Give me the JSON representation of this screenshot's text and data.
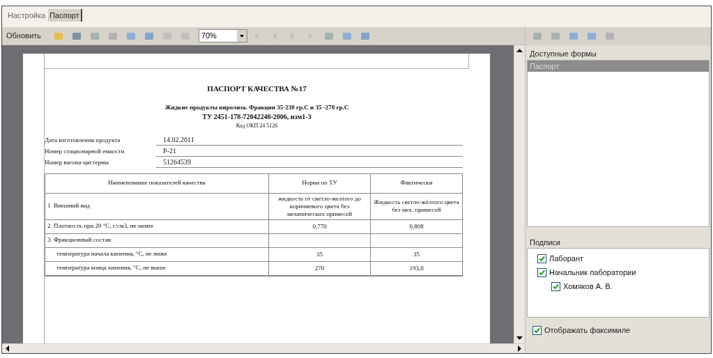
{
  "tabs": [
    {
      "label": "Настройка",
      "selected": false
    },
    {
      "label": "Паспорт",
      "selected": true
    }
  ],
  "toolbar": {
    "refresh": "Обновить",
    "zoom": "70%"
  },
  "document": {
    "title": "ПАСПОРТ КАЧЕСТВА №17",
    "subtitle": "Жидкие продукты пиролиза. Фракции 35-230 гр.С и 35 -270 гр.С",
    "spec": "ТУ 2451-178-72042240-2006, изм1-3",
    "code": "Код ОКП 24 5126",
    "fields": [
      {
        "label": "Дата изготовления продукта",
        "value": "14.02.2011"
      },
      {
        "label": "Номер стационарной емкости",
        "value": "Р-21"
      },
      {
        "label": "Номер вагона-цистерны",
        "value": "51264539"
      }
    ],
    "table": {
      "columns": [
        "Наименование показателей качества",
        "Норма по ТУ",
        "Фактически"
      ],
      "rows": [
        {
          "kind": "item",
          "cells": [
            "1. Внешний вид",
            "жидкость от светло-желтого до коричневого цвета без механических примесей",
            "Жидкость светло-жёлтого цвета без мех. примесей"
          ]
        },
        {
          "kind": "item",
          "cells": [
            "2. Плотность при 20 °С, г/см3, не менее",
            "0,770",
            "0,808"
          ]
        },
        {
          "kind": "item",
          "cells": [
            "3. Фракционный состав:",
            "",
            ""
          ]
        },
        {
          "kind": "sub",
          "cells": [
            "температура начала кипения, °С, не ниже",
            "35",
            "35"
          ]
        },
        {
          "kind": "sub",
          "cells": [
            "температура конца кипения, °С, не выше",
            "270",
            "193,0"
          ]
        }
      ]
    }
  },
  "forms": {
    "label": "Доступные формы",
    "items": [
      {
        "label": "Паспорт",
        "selected": true
      }
    ]
  },
  "signatures": {
    "label": "Подписи",
    "items": [
      {
        "label": "Лаборант",
        "checked": true
      },
      {
        "label": "Начальник лаборатории",
        "checked": true,
        "children": [
          {
            "label": "Хомяков А. В.",
            "checked": true
          }
        ]
      }
    ]
  },
  "facsimile": {
    "label": "Отображать факсимиле",
    "checked": true
  }
}
